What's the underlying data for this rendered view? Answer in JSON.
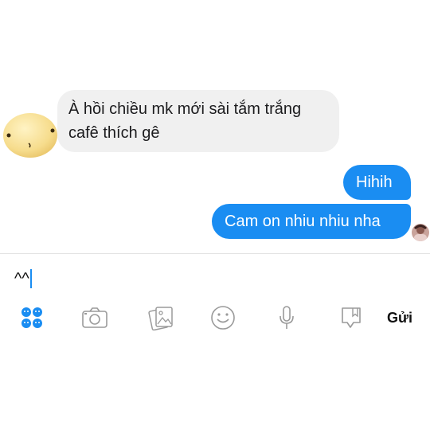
{
  "conversation": {
    "incoming": {
      "lines": [
        "À hồi chiều mk mới sài tắm trắng",
        "cafê thích gê"
      ]
    },
    "outgoing": [
      {
        "text": "Hihih"
      },
      {
        "text": "Cam on nhiu nhiu nha"
      }
    ]
  },
  "composer": {
    "input_value": "^^",
    "toolbar": {
      "icons": [
        "apps-icon",
        "camera-icon",
        "gallery-icon",
        "emoji-icon",
        "microphone-icon",
        "sticker-icon"
      ],
      "send_label": "Gửi"
    }
  },
  "colors": {
    "outgoing_bubble": "#1a8df2",
    "incoming_bubble": "#f0f0f0",
    "accent": "#1a8df2",
    "icon_gray": "#9a9a9a"
  }
}
